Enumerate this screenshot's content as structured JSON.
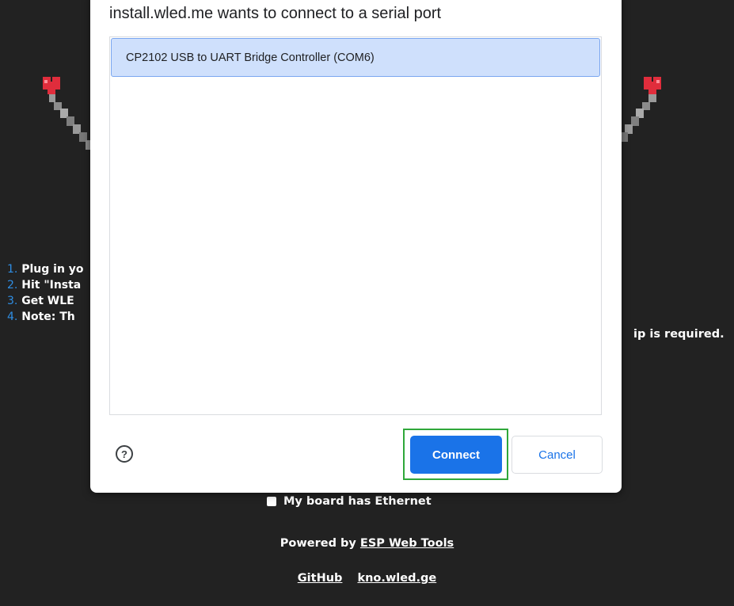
{
  "dialog": {
    "title": "install.wled.me wants to connect to a serial port",
    "ports": [
      "CP2102 USB to UART Bridge Controller (COM6)"
    ],
    "help_icon": "?",
    "connect_label": "Connect",
    "cancel_label": "Cancel",
    "accent_color": "#1a73e8"
  },
  "steps": [
    {
      "num": "1.",
      "text": "Plug in yo"
    },
    {
      "num": "2.",
      "text": "Hit \"Insta"
    },
    {
      "num": "3.",
      "text": "Get WLE"
    },
    {
      "num": "4.",
      "text": "Note: Th"
    }
  ],
  "note_tail": "ip is required.",
  "ethernet_label": "My board has Ethernet",
  "powered_prefix": "Powered by",
  "powered_link": "ESP Web Tools",
  "footer_links": [
    "GitHub",
    "kno.wled.ge"
  ],
  "background_color": "#222222"
}
